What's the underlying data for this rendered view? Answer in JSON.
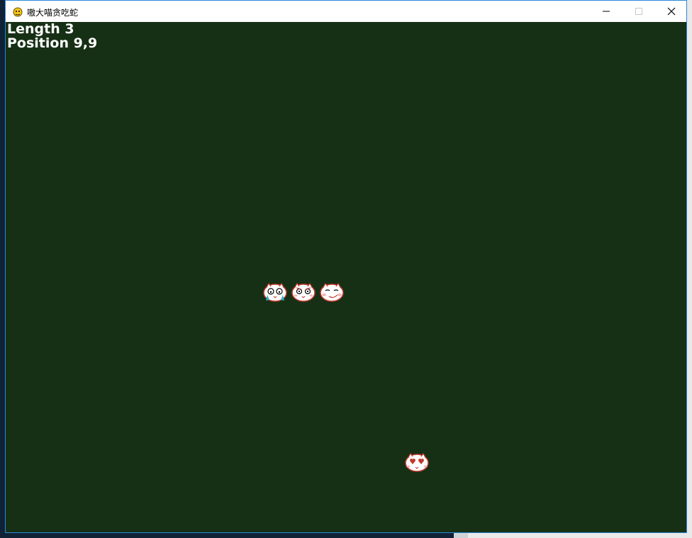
{
  "window": {
    "title": "嗷大喵贪吃蛇",
    "minimize_icon": "minimize-icon",
    "maximize_icon": "maximize-icon",
    "close_icon": "close-icon"
  },
  "hud": {
    "length_text": "Length 3",
    "position_text": "Position 9,9"
  },
  "game": {
    "background_color": "#163016",
    "snake_length": 3,
    "head_position": [
      9,
      9
    ],
    "snake_segments": [
      "crying-cat-face-icon",
      "worried-cat-face-icon",
      "smirking-cat-face-icon"
    ],
    "food": "heart-eyes-cat-face-icon"
  },
  "colors": {
    "face_outline": "#c0392b",
    "face_fill": "#ffffff",
    "accent_blue": "#2b88d8"
  }
}
